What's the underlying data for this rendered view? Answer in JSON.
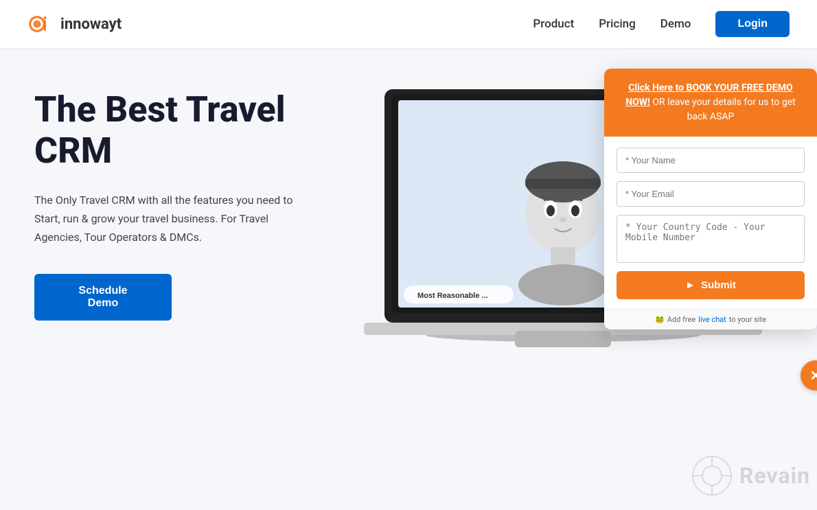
{
  "brand": {
    "name": "innowayt",
    "logo_alt": "innowayt logo"
  },
  "nav": {
    "product_label": "Product",
    "pricing_label": "Pricing",
    "demo_label": "Demo",
    "login_label": "Login"
  },
  "hero": {
    "title_line1": "The Best Travel",
    "title_line2": "CRM",
    "subtitle": "The Only Travel CRM with all the features you need to Start, run & grow your travel business. For Travel Agencies, Tour Operators & DMCs.",
    "cta_label": "Schedule Demo"
  },
  "screen": {
    "badge": "Most Reasonable ..."
  },
  "popup": {
    "header_text_1": "Click Here to BOOK YOUR FREE DEMO NOW!",
    "header_text_2": " OR leave your details for us to get back ASAP",
    "name_placeholder": "* Your Name",
    "email_placeholder": "* Your Email",
    "mobile_placeholder": "* Your Country Code - Your Mobile Number",
    "submit_label": "Submit",
    "footer_text_1": "Add free",
    "footer_link": "live chat",
    "footer_text_2": "to your site"
  },
  "revain": {
    "label": "Revain"
  }
}
